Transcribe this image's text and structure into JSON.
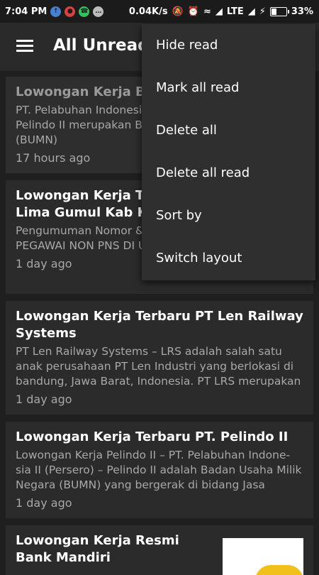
{
  "status_bar": {
    "time": "7:04 PM",
    "speed": "0.04K/s",
    "network": "LTE",
    "battery": "33%",
    "battery_level": 0.33,
    "notification_icons": [
      "usb-icon",
      "app-icon",
      "whatsapp-icon",
      "more-icon"
    ],
    "system_icons": [
      "mute-icon",
      "alarm-icon",
      "wifi-icon",
      "signal-icon",
      "signal-icon",
      "data-saver-icon",
      "battery-icon"
    ]
  },
  "toolbar": {
    "title": "All Unreads"
  },
  "articles": [
    {
      "title": "Lowongan Kerja BUMN",
      "snippet": "PT. Pelabuhan Indonesia II (Persero) – disebut PT Pelindo II merupakan Badan Usaha Milik Negara (BUMN)",
      "time": "17 hours ago",
      "read": true
    },
    {
      "title": "Lowongan Kerja Terbaru UPTD RSU Lima Gumul Kab Kediri",
      "snippet": "Pengumuman Nomor & Tentang PENERIMAAN PEGAWAI NON PNS DI UPTD RSUD",
      "time": "1 day ago",
      "read": false
    },
    {
      "title": "Lowongan Kerja Terbaru PT Len Railway Systems",
      "snippet": "PT Len Railway Systems – LRS adalah salah satu anak perusahaan PT Len Industri yang berlokasi di bandung, Jawa Barat, Indonesia. PT LRS merupakan",
      "time": "1 day ago",
      "read": false
    },
    {
      "title": "Lowongan Kerja Terbaru PT. Pelindo II",
      "snippet": "Lowongan Kerja Pelindo II – PT. Pelabuhan Indone-sia II (Persero) – Pelindo II adalah Badan Usaha Milik Negara (BUMN) yang bergerak di bidang Jasa",
      "time": "1 day ago",
      "read": false
    },
    {
      "title": "Lowongan Kerja Resmi Bank Mandiri",
      "snippet": "",
      "time": "",
      "read": false,
      "has_thumbnail": true
    }
  ],
  "overflow_menu": {
    "items": [
      "Hide read",
      "Mark all read",
      "Delete all",
      "Delete all read",
      "Sort by",
      "Switch layout"
    ]
  }
}
